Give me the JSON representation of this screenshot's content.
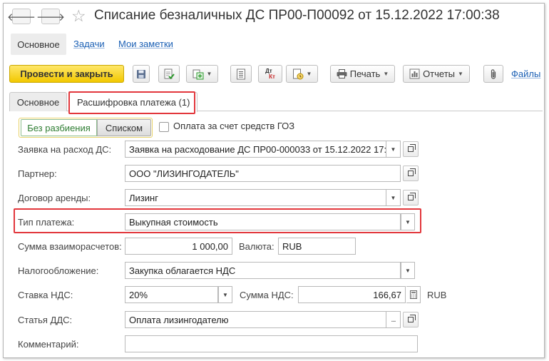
{
  "window": {
    "title": "Списание безналичных ДС ПР00-П00092 от 15.12.2022 17:00:38",
    "back_glyph": "🡐",
    "forward_glyph": "🡒",
    "star_glyph": "☆"
  },
  "sections": {
    "main": "Основное",
    "tasks": "Задачи",
    "notes": "Мои заметки"
  },
  "toolbar": {
    "post_close": "Провести и закрыть",
    "print": "Печать",
    "reports": "Отчеты",
    "files": "Файлы",
    "dt_kt_top": "Дт",
    "dt_kt_bottom": "Кт"
  },
  "tabs": {
    "main": "Основное",
    "decoding": "Расшифровка платежа (1)"
  },
  "mode": {
    "no_split": "Без разбиения",
    "list": "Списком",
    "goz_label": "Оплата за счет средств ГОЗ",
    "goz_checked": false
  },
  "form": {
    "request_label": "Заявка на расход ДС:",
    "request_value": "Заявка на расходование ДС ПР00-000033 от 15.12.2022 17:",
    "partner_label": "Партнер:",
    "partner_value": "ООО \"ЛИЗИНГОДАТЕЛЬ\"",
    "contract_label": "Договор аренды:",
    "contract_value": "Лизинг",
    "paytype_label": "Тип платежа:",
    "paytype_value": "Выкупная стоимость",
    "amount_label": "Сумма взаиморасчетов:",
    "amount_value": "1 000,00",
    "currency_label": "Валюта:",
    "currency_value": "RUB",
    "tax_label": "Налогообложение:",
    "tax_value": "Закупка облагается НДС",
    "vat_rate_label": "Ставка НДС:",
    "vat_rate_value": "20%",
    "vat_sum_label": "Сумма НДС:",
    "vat_sum_value": "166,67",
    "vat_currency": "RUB",
    "dds_label": "Статья ДДС:",
    "dds_value": "Оплата лизингодателю",
    "comment_label": "Комментарий:",
    "comment_value": ""
  },
  "colors": {
    "highlight": "#e2373c",
    "primary_button": "#f2c800",
    "link": "#1a5fb4"
  }
}
